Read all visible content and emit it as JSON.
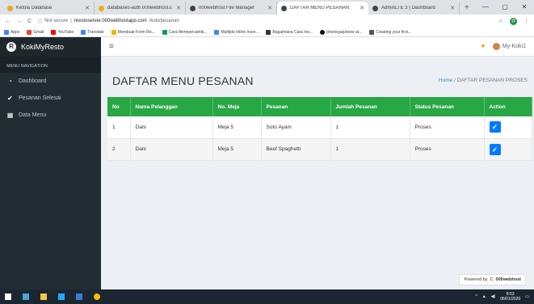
{
  "browser": {
    "tabs": [
      {
        "label": "Ketola Database",
        "color": "#f0a02a"
      },
      {
        "label": "databases-auth.000webhost.c",
        "color": "#e8b10e"
      },
      {
        "label": "000webhost File Manager",
        "color": "#444"
      },
      {
        "label": "DAFTAR MENU PESANAN",
        "color": "#444",
        "active": true
      },
      {
        "label": "AdminLTE 3 | Dashboard",
        "color": "#444"
      }
    ],
    "new_tab": "+",
    "security": "Not secure",
    "url_host": "nrestoserver.000webhostapp.com",
    "url_path": "/koki/pesanan",
    "avatar_letter": "@",
    "bookmarks": [
      {
        "label": "Apps",
        "color": "#4285f4"
      },
      {
        "label": "Gmail",
        "color": "#ea4335"
      },
      {
        "label": "YouTube",
        "color": "#ff0000"
      },
      {
        "label": "Translate",
        "color": "#4285f4"
      },
      {
        "label": "Membuat Form Re...",
        "color": "#f4b400"
      },
      {
        "label": "Cara Mempercantik...",
        "color": "#0f9d58"
      },
      {
        "label": "Multiple Inline Inser...",
        "color": "#4285f4"
      },
      {
        "label": "Bagaimana Cara Ins...",
        "color": "#333"
      },
      {
        "label": "phonegap/www at...",
        "color": "#111"
      },
      {
        "label": "Creating your first...",
        "color": "#555"
      }
    ]
  },
  "app": {
    "brand": "KokiMyResto",
    "brand_logo": "R",
    "nav_header": "MENU NAVIGATION",
    "nav": [
      {
        "label": "Dashboard",
        "icon": "dashboard-icon",
        "glyph": "◔"
      },
      {
        "label": "Pesanan Selesai",
        "icon": "check-icon",
        "glyph": "✔"
      },
      {
        "label": "Data Menu",
        "icon": "table-icon",
        "glyph": "▦"
      }
    ],
    "user": "My-Koki1"
  },
  "page": {
    "title": "DAFTAR MENU PESANAN",
    "breadcrumb_home": "Home",
    "breadcrumb_sep": "/",
    "breadcrumb_current": "DAFTAR PESANAN PROSES"
  },
  "table": {
    "columns": [
      "No",
      "Nama Pelanggan",
      "No. Meja",
      "Pesanan",
      "Jumlah Pesanan",
      "Status Pesanan",
      "Action"
    ],
    "rows": [
      [
        "1",
        "Dani",
        "Meja 5",
        "Soto Ayam",
        "1",
        "Proses"
      ],
      [
        "2",
        "Dani",
        "Meja 5",
        "Beef Spaghetti",
        "1",
        "Proses"
      ]
    ]
  },
  "footer": {
    "powered_by": "Powered by",
    "host": "000webhost"
  },
  "taskbar": {
    "time": "8:53",
    "date": "06/01/2020"
  },
  "colors": {
    "header_green": "#28a745",
    "action_blue": "#007bff",
    "sidebar": "#222d32"
  }
}
